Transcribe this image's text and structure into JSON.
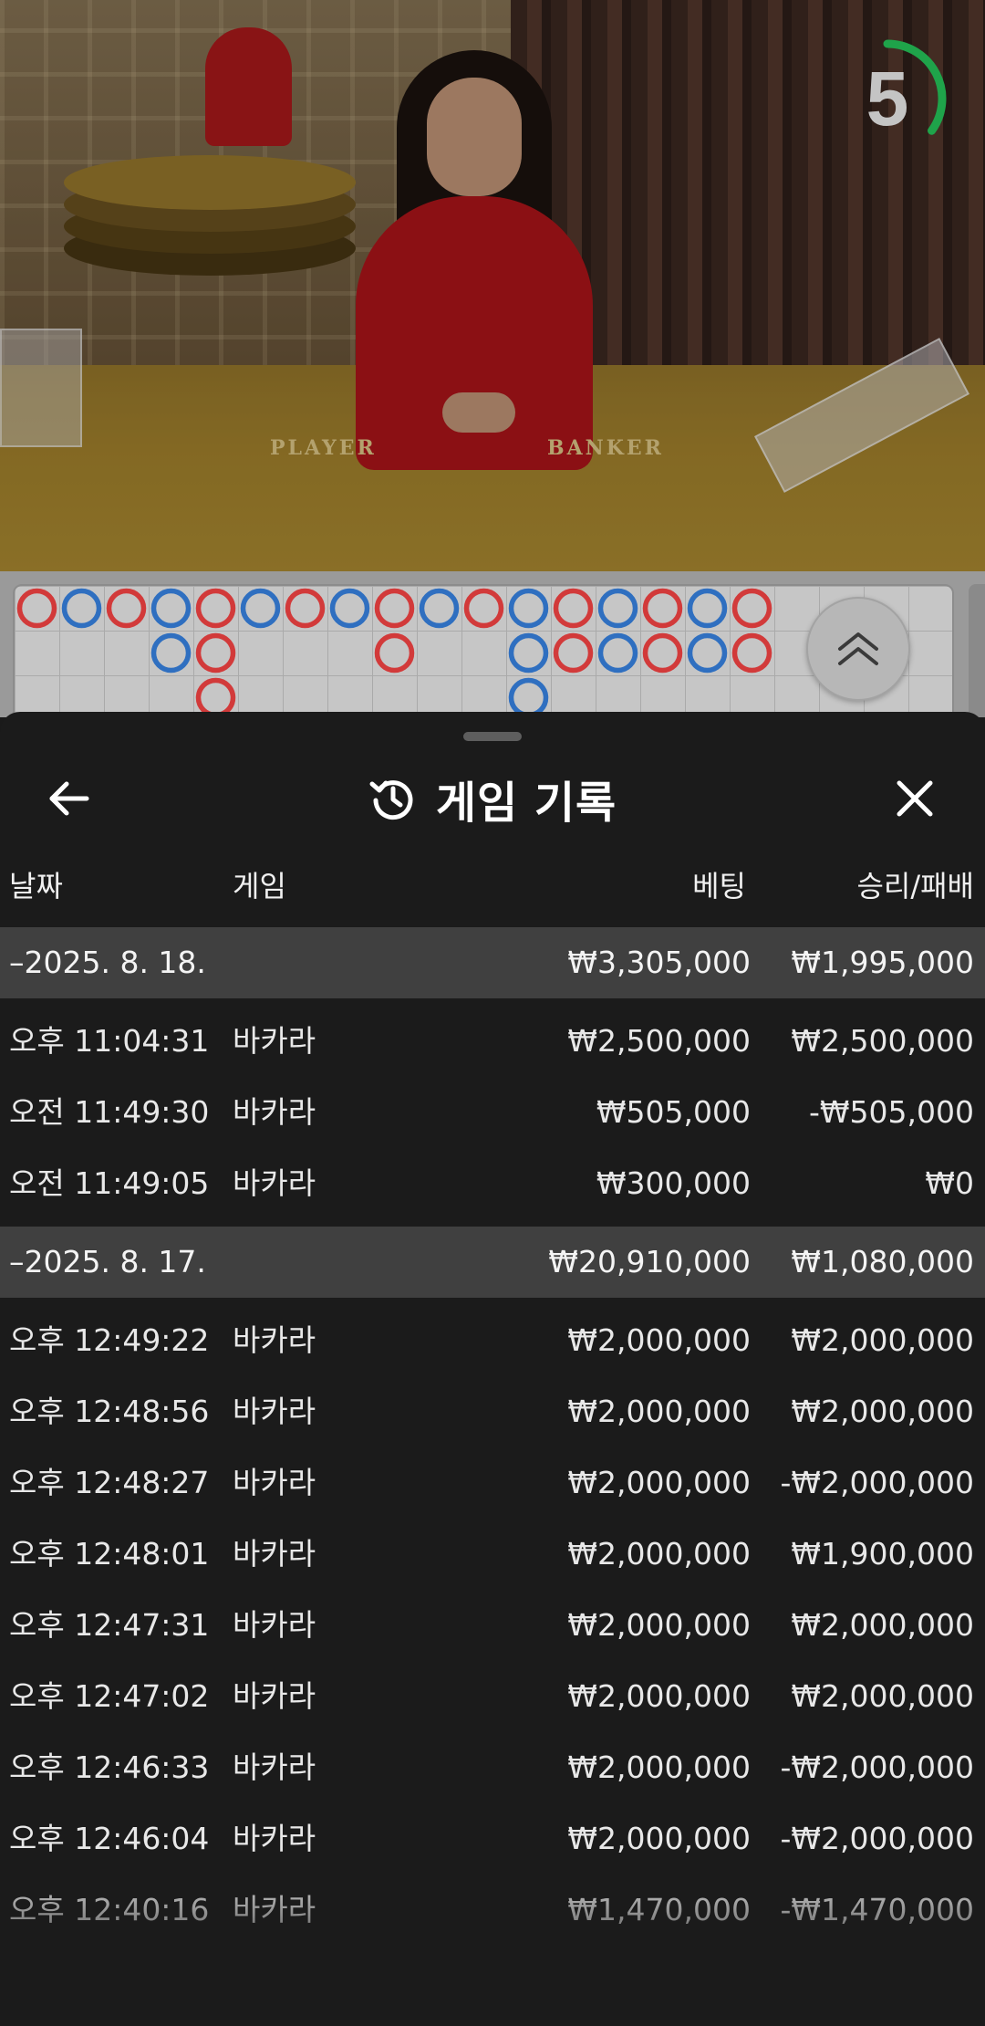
{
  "video": {
    "table_labels": [
      "PLAYER",
      "BANKER"
    ],
    "countdown": "5",
    "countdown_fraction": 0.35,
    "timer_color": "#1fa34a"
  },
  "roadmap": {
    "colors": {
      "player": "#2f6fc0",
      "banker": "#d23a3a",
      "tie_slash": "#1f8a3a"
    },
    "columns": [
      [
        "B"
      ],
      [
        "P"
      ],
      [
        "B"
      ],
      [
        "P",
        "P"
      ],
      [
        "B",
        "B",
        "B"
      ],
      [
        "P"
      ],
      [
        "B"
      ],
      [
        "P"
      ],
      [
        "B",
        "B"
      ],
      [
        "P"
      ],
      [
        "B"
      ],
      [
        "P",
        "P",
        "P"
      ],
      [
        "B",
        "B"
      ],
      [
        "P",
        "P"
      ],
      [
        "B",
        "B"
      ],
      [
        "P",
        "P"
      ],
      [
        "B",
        "B"
      ]
    ],
    "expand_icon": "double-chevron-up-icon"
  },
  "sheet": {
    "title": "게임 기록",
    "title_icon": "history-icon",
    "back_icon": "arrow-left-icon",
    "close_icon": "close-icon",
    "columns": {
      "date": "날짜",
      "game": "게임",
      "bet": "베팅",
      "result": "승리/패배"
    },
    "groups": [
      {
        "date": "–2025. 8. 18.",
        "bet": "₩3,305,000",
        "result": "₩1,995,000",
        "rows": [
          {
            "time": "오후 11:04:31",
            "game": "바카라",
            "bet": "₩2,500,000",
            "result": "₩2,500,000"
          },
          {
            "time": "오전 11:49:30",
            "game": "바카라",
            "bet": "₩505,000",
            "result": "-₩505,000"
          },
          {
            "time": "오전 11:49:05",
            "game": "바카라",
            "bet": "₩300,000",
            "result": "₩0"
          }
        ]
      },
      {
        "date": "–2025. 8. 17.",
        "bet": "₩20,910,000",
        "result": "₩1,080,000",
        "rows": [
          {
            "time": "오후 12:49:22",
            "game": "바카라",
            "bet": "₩2,000,000",
            "result": "₩2,000,000"
          },
          {
            "time": "오후 12:48:56",
            "game": "바카라",
            "bet": "₩2,000,000",
            "result": "₩2,000,000"
          },
          {
            "time": "오후 12:48:27",
            "game": "바카라",
            "bet": "₩2,000,000",
            "result": "-₩2,000,000"
          },
          {
            "time": "오후 12:48:01",
            "game": "바카라",
            "bet": "₩2,000,000",
            "result": "₩1,900,000"
          },
          {
            "time": "오후 12:47:31",
            "game": "바카라",
            "bet": "₩2,000,000",
            "result": "₩2,000,000"
          },
          {
            "time": "오후 12:47:02",
            "game": "바카라",
            "bet": "₩2,000,000",
            "result": "₩2,000,000"
          },
          {
            "time": "오후 12:46:33",
            "game": "바카라",
            "bet": "₩2,000,000",
            "result": "-₩2,000,000"
          },
          {
            "time": "오후 12:46:04",
            "game": "바카라",
            "bet": "₩2,000,000",
            "result": "-₩2,000,000"
          },
          {
            "time": "오후 12:40:16",
            "game": "바카라",
            "bet": "₩1,470,000",
            "result": "-₩1,470,000"
          }
        ]
      }
    ]
  }
}
